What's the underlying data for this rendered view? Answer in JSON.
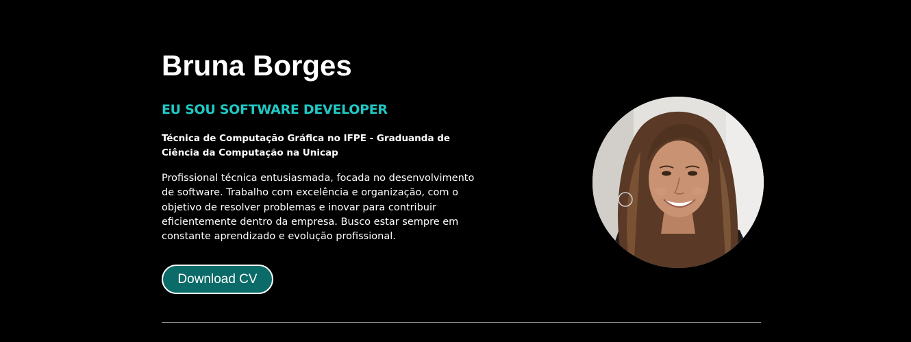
{
  "profile": {
    "name": "Bruna Borges",
    "role": "EU SOU SOFTWARE DEVELOPER",
    "headline": "Técnica de Computação Gráfica no IFPE - Graduanda de Ciência da Computação na Unicap",
    "bio": "Profissional técnica entusiasmada, focada no desenvolvimento de software. Trabalho com excelência e organização, com o objetivo de resolver problemas e inovar para contribuir eficientemente dentro da empresa. Busco estar sempre em constante aprendizado e evolução profissional.",
    "cv_button_label": "Download CV",
    "avatar_icon": "profile-photo"
  },
  "colors": {
    "background": "#000000",
    "accent": "#1fc8c4",
    "button_fill": "#0b6b68",
    "text": "#ffffff",
    "divider": "#8a8a8a"
  }
}
